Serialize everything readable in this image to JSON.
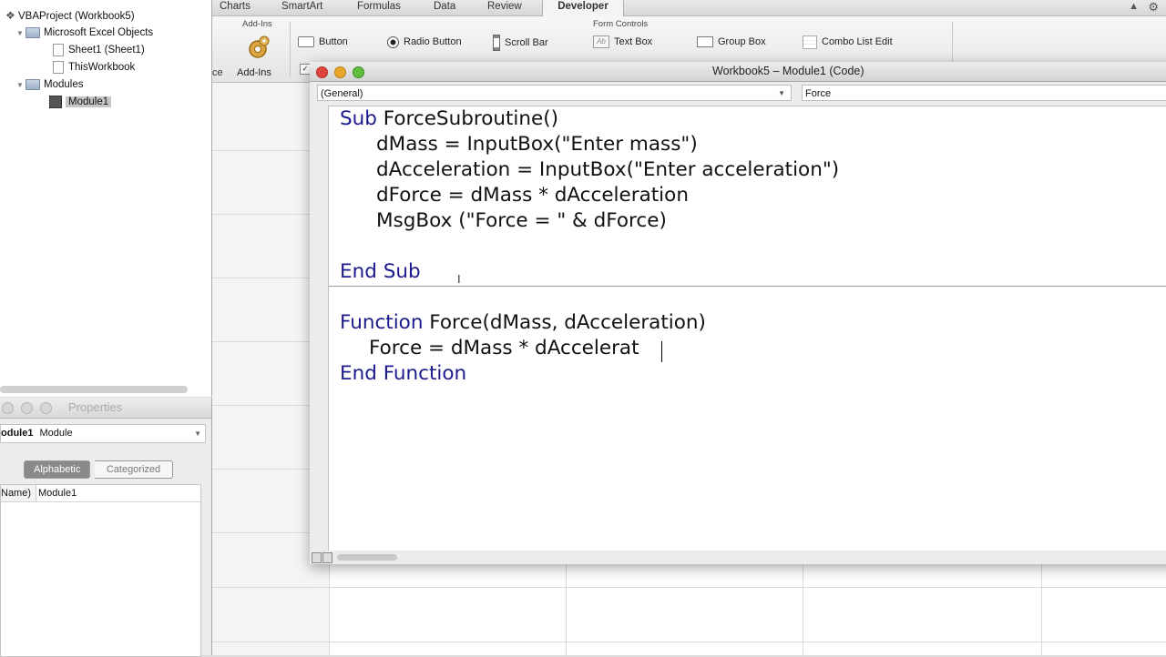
{
  "ribbon": {
    "tabs": [
      "Charts",
      "SmartArt",
      "Formulas",
      "Data",
      "Review",
      "Developer"
    ],
    "active_tab": "Developer",
    "groups": {
      "addins_title": "Add-Ins",
      "addins_button": "Add-Ins",
      "form_controls_title": "Form Controls"
    },
    "controls": {
      "button": "Button",
      "radio_button": "Radio Button",
      "scroll_bar": "Scroll Bar",
      "text_box": "Text Box",
      "group_box": "Group Box",
      "combo_list_edit": "Combo List Edit",
      "partial_left": "ce"
    }
  },
  "project_explorer": {
    "root": "VBAProject (Workbook5)",
    "excel_objects": "Microsoft Excel Objects",
    "sheet1": "Sheet1 (Sheet1)",
    "this_workbook": "ThisWorkbook",
    "modules": "Modules",
    "module1": "Module1"
  },
  "properties": {
    "title": "Properties",
    "object_name": "odule1",
    "object_type": "Module",
    "tab_alphabetic": "Alphabetic",
    "tab_categorized": "Categorized",
    "row_name": "Name)",
    "row_value": "Module1"
  },
  "code_window": {
    "title": "Workbook5 – Module1 (Code)",
    "object_combo": "(General)",
    "proc_combo": "Force",
    "lines": {
      "l1_kw": "Sub",
      "l1_rest": " ForceSubroutine()",
      "l2": "dMass = InputBox(\"Enter mass\")",
      "l3": "dAcceleration = InputBox(\"Enter acceleration\")",
      "l4": "dForce = dMass * dAcceleration",
      "l5": "MsgBox (\"Force = \" & dForce)",
      "l6": "End Sub",
      "l7_kw": "Function",
      "l7_rest": " Force(dMass, dAcceleration)",
      "l8": "Force = dMass * dAccelerat",
      "l9": "End Function"
    }
  },
  "colors": {
    "keyword": "#1a1a8c",
    "close_light": "#e0443e",
    "minimize_light": "#e8a62b",
    "zoom_light": "#5fbf3f"
  }
}
